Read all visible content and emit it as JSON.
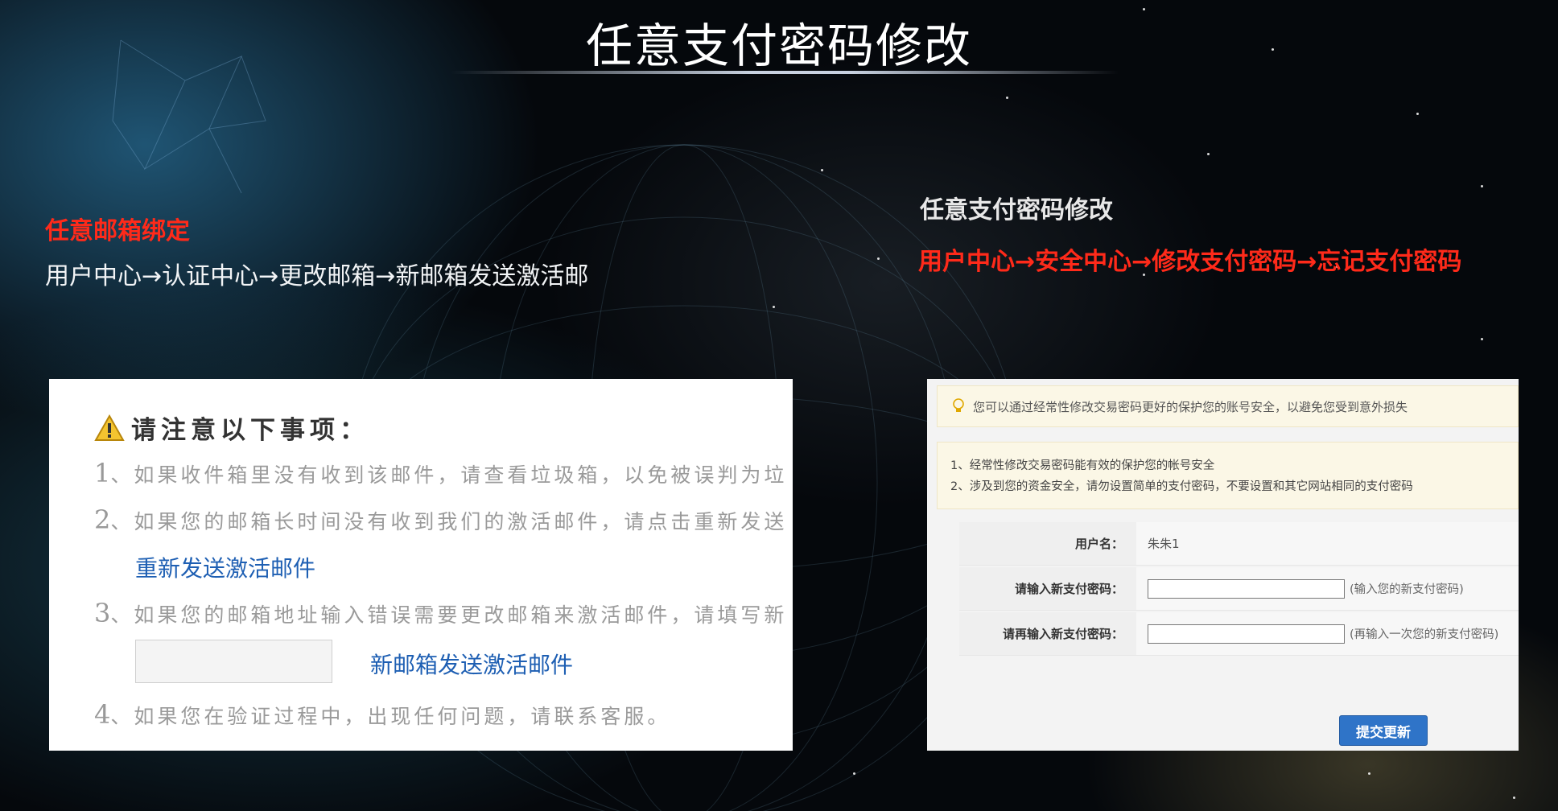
{
  "slide": {
    "title": "任意支付密码修改"
  },
  "left_section": {
    "heading": "任意邮箱绑定",
    "path": "用户中心→认证中心→更改邮箱→新邮箱发送激活邮"
  },
  "right_section": {
    "heading": "任意支付密码修改",
    "path": "用户中心→安全中心→修改支付密码→忘记支付密码"
  },
  "email_panel": {
    "warning_title": "请注意以下事项：",
    "notes": [
      {
        "num": "1",
        "text": "、如果收件箱里没有收到该邮件，请查看垃圾箱，以免被误判为垃"
      },
      {
        "num": "2",
        "text": "、如果您的邮箱长时间没有收到我们的激活邮件，请点击重新发送"
      },
      {
        "num": "3",
        "text": "、如果您的邮箱地址输入错误需要更改邮箱来激活邮件，请填写新"
      },
      {
        "num": "4",
        "text": "、如果您在验证过程中，出现任何问题，请联系客服。"
      }
    ],
    "resend_link": "重新发送激活邮件",
    "new_email_link": "新邮箱发送激活邮件",
    "new_email_value": ""
  },
  "payment_panel": {
    "tip": "您可以通过经常性修改交易密码更好的保护您的账号安全，以避免您受到意外损失",
    "info_lines": [
      "1、经常性修改交易密码能有效的保护您的帐号安全",
      "2、涉及到您的资金安全，请勿设置简单的支付密码，不要设置和其它网站相同的支付密码"
    ],
    "username_label": "用户名：",
    "username_value": "朱朱1",
    "new_password_label": "请输入新支付密码：",
    "new_password_hint": "(输入您的新支付密码)",
    "confirm_password_label": "请再输入新支付密码：",
    "confirm_password_hint": "(再输入一次您的新支付密码)",
    "submit_label": "提交更新",
    "icons": {
      "tip": "lightbulb-icon",
      "warning": "warning-icon"
    },
    "colors": {
      "accent": "#2f74c8",
      "tip_bg": "#fbf7e6"
    }
  },
  "colors": {
    "red_label": "#ff2a1a",
    "link": "#1e5fb3"
  }
}
